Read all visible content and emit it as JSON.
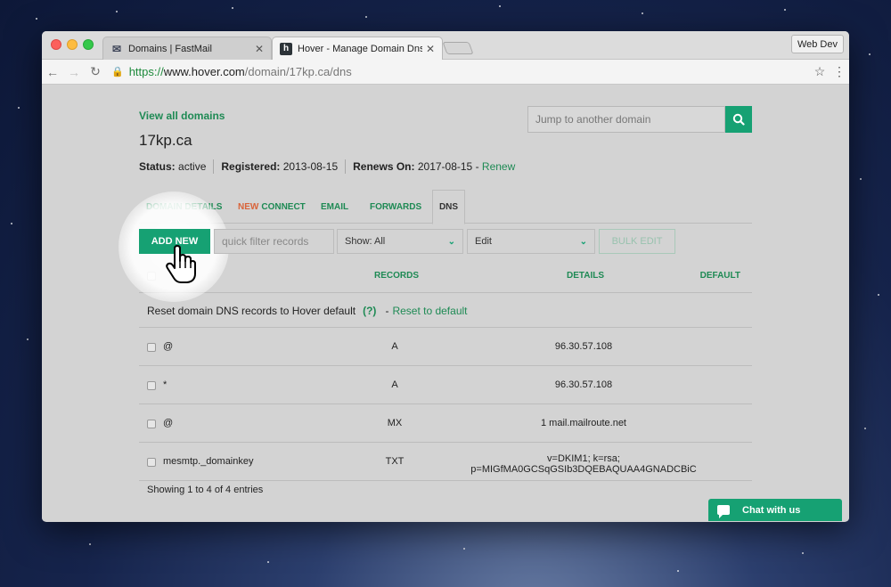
{
  "browser": {
    "tabs": [
      {
        "title": "Domains | FastMail",
        "icon": "mail-icon"
      },
      {
        "title": "Hover - Manage Domain Dns",
        "icon": "hover-favicon",
        "active": true
      }
    ],
    "profile": "Web Dev",
    "url": {
      "scheme": "https://",
      "host": "www.hover.com",
      "path": "/domain/17kp.ca/dns"
    }
  },
  "page": {
    "view_all": "View all domains",
    "domain": "17kp.ca",
    "status_label": "Status:",
    "status_value": "active",
    "registered_label": "Registered:",
    "registered_value": "2013-08-15",
    "renews_label": "Renews On:",
    "renews_value": "2017-08-15",
    "renews_sep": "-",
    "renew_link": "Renew",
    "jump_placeholder": "Jump to another domain",
    "tabs": {
      "details": "DOMAIN DETAILS",
      "connect_new": "NEW",
      "connect": "CONNECT",
      "email": "EMAIL",
      "forwards": "FORWARDS",
      "dns": "DNS"
    },
    "actions": {
      "add_new": "ADD NEW",
      "filter_placeholder": "quick filter records",
      "show": "Show: All",
      "edit": "Edit",
      "bulk_edit": "BULK EDIT"
    },
    "table": {
      "headers": {
        "records": "RECORDS",
        "details": "DETAILS",
        "default": "DEFAULT"
      },
      "reset_text": "Reset domain DNS records to Hover default",
      "help": "(?)",
      "reset_sep": "-",
      "reset_link": "Reset to default",
      "rows": [
        {
          "name": "@",
          "type": "A",
          "details": "96.30.57.108"
        },
        {
          "name": "*",
          "type": "A",
          "details": "96.30.57.108"
        },
        {
          "name": "@",
          "type": "MX",
          "details": "1 mail.mailroute.net"
        },
        {
          "name": "mesmtp._domainkey",
          "type": "TXT",
          "details": "v=DKIM1; k=rsa;",
          "details2": "p=MIGfMA0GCSqGSIb3DQEBAQUAA4GNADCBiC"
        }
      ],
      "footer": "Showing 1 to 4 of 4 entries"
    },
    "chat": "Chat with us"
  },
  "colors": {
    "accent": "#16a173",
    "link": "#1e8a54",
    "new_badge": "#d9643a"
  }
}
